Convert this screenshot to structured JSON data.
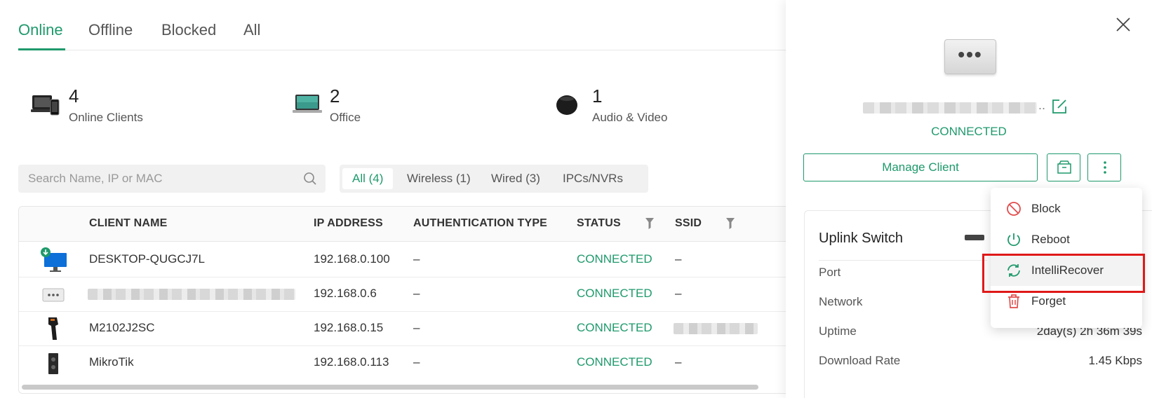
{
  "tabs": [
    "Online",
    "Offline",
    "Blocked",
    "All"
  ],
  "stats": [
    {
      "count": "4",
      "label": "Online Clients",
      "icon": "devices-icon"
    },
    {
      "count": "2",
      "label": "Office",
      "icon": "laptop-icon"
    },
    {
      "count": "1",
      "label": "Audio & Video",
      "icon": "speaker-icon"
    }
  ],
  "search": {
    "placeholder": "Search Name, IP or MAC"
  },
  "filters": [
    "All (4)",
    "Wireless (1)",
    "Wired (3)",
    "IPCs/NVRs"
  ],
  "table": {
    "columns": [
      "CLIENT NAME",
      "IP ADDRESS",
      "AUTHENTICATION TYPE",
      "STATUS",
      "SSID"
    ],
    "rows": [
      {
        "name": "DESKTOP-QUGCJ7L",
        "ip": "192.168.0.100",
        "auth": "–",
        "status": "CONNECTED",
        "ssid": "–",
        "icon": "desktop-icon"
      },
      {
        "name": "",
        "ip": "192.168.0.6",
        "auth": "–",
        "status": "CONNECTED",
        "ssid": "–",
        "icon": "generic-device-icon"
      },
      {
        "name": "M2102J2SC",
        "ip": "192.168.0.15",
        "auth": "–",
        "status": "CONNECTED",
        "ssid": "",
        "icon": "phone-icon"
      },
      {
        "name": "MikroTik",
        "ip": "192.168.0.113",
        "auth": "–",
        "status": "CONNECTED",
        "ssid": "–",
        "icon": "router-icon"
      }
    ]
  },
  "drawer": {
    "name_suffix": "..",
    "status": "CONNECTED",
    "manage_label": "Manage Client",
    "card": {
      "title": "Uplink Switch",
      "rows": [
        {
          "label": "Port",
          "value": ""
        },
        {
          "label": "Network",
          "value": ""
        },
        {
          "label": "Uptime",
          "value": "2day(s) 2h 36m 39s"
        },
        {
          "label": "Download Rate",
          "value": "1.45 Kbps"
        }
      ]
    }
  },
  "menu": [
    "Block",
    "Reboot",
    "IntelliRecover",
    "Forget"
  ],
  "colors": {
    "accent": "#1f9a6c",
    "danger": "#e24b4b",
    "highlight": "#e01919"
  }
}
